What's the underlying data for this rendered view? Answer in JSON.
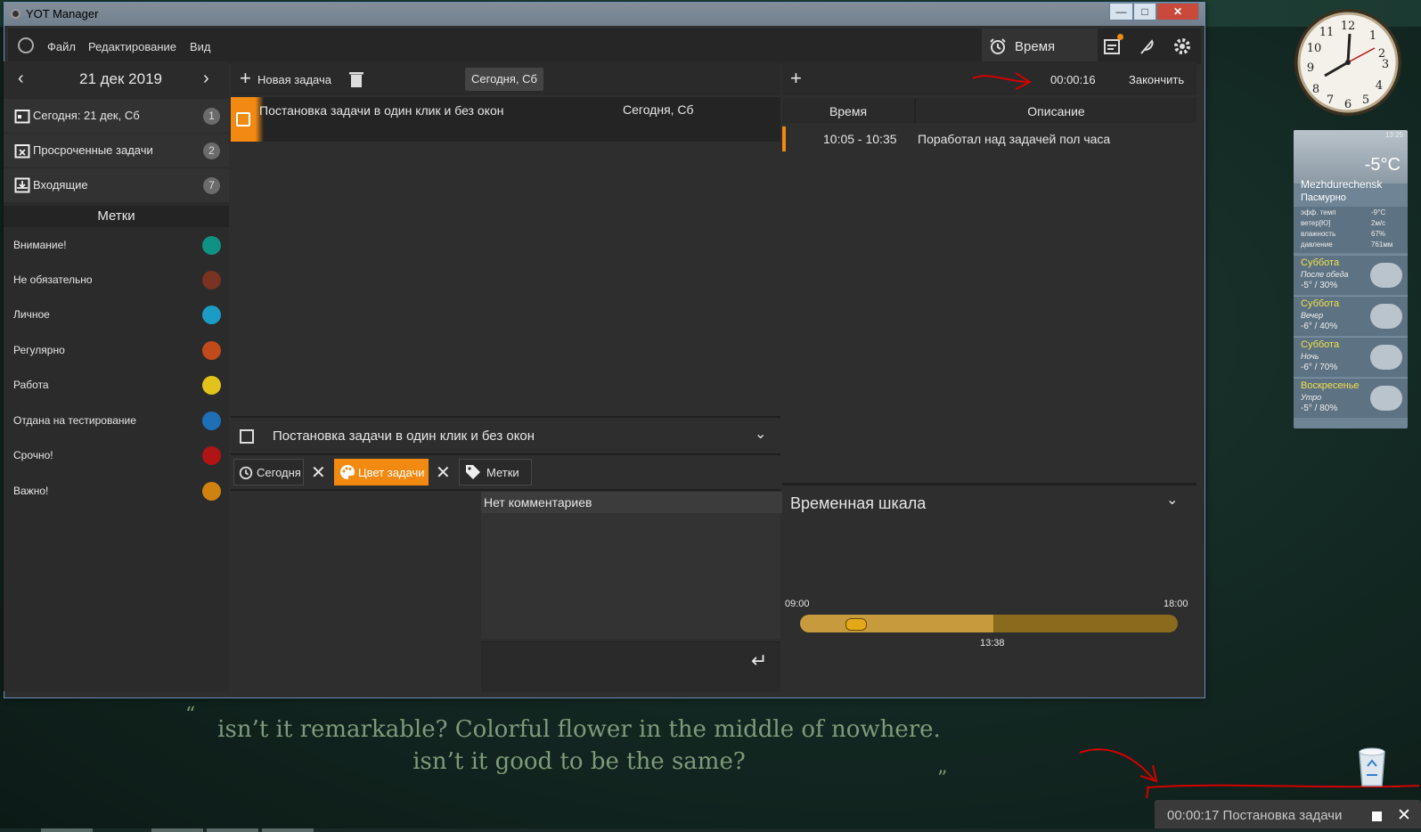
{
  "window": {
    "title": "YOT Manager"
  },
  "menu": {
    "file": "Файл",
    "edit": "Редактирование",
    "view": "Вид",
    "time_tab": "Время"
  },
  "nav": {
    "date": "21 дек 2019"
  },
  "sidebar": {
    "items": [
      {
        "label": "Сегодня: 21 дек, Сб",
        "count": "1",
        "icon": "calendar-icon"
      },
      {
        "label": "Просроченные задачи",
        "count": "2",
        "icon": "calendar-overdue-icon"
      },
      {
        "label": "Входящие",
        "count": "7",
        "icon": "inbox-icon"
      }
    ],
    "tags_header": "Метки",
    "tags": [
      {
        "label": "Внимание!",
        "color": "#0f9184"
      },
      {
        "label": "Не обязательно",
        "color": "#7a3222"
      },
      {
        "label": "Личное",
        "color": "#1c9cc4"
      },
      {
        "label": "Регулярно",
        "color": "#c14a1a"
      },
      {
        "label": "Работа",
        "color": "#e2c31c"
      },
      {
        "label": "Отдана на тестирование",
        "color": "#1f6fb6"
      },
      {
        "label": "Срочно!",
        "color": "#b01414"
      },
      {
        "label": "Важно!",
        "color": "#cf8210"
      }
    ]
  },
  "tasks_toolbar": {
    "new_task": "Новая задача",
    "filter": "Сегодня, Сб"
  },
  "task_list": [
    {
      "title": "Постановка задачи в один клик и без окон",
      "date": "Сегодня, Сб",
      "color": "#f28a12"
    }
  ],
  "task_detail": {
    "title": "Постановка задачи в один клик и без окон",
    "date_chip": "Сегодня",
    "color_chip": "Цвет задачи",
    "tags_chip": "Метки",
    "comments_empty": "Нет комментариев"
  },
  "timer": {
    "elapsed": "00:00:16",
    "finish": "Закончить"
  },
  "time_table": {
    "headers": [
      "Время",
      "Описание"
    ],
    "rows": [
      {
        "time": "10:05 - 10:35",
        "desc": "Поработал над задачей пол часа"
      }
    ]
  },
  "timeline": {
    "title": "Временная шкала",
    "start": "09:00",
    "end": "18:00",
    "now": "13:38"
  },
  "desktop": {
    "quote_open": "“",
    "quote_line1": "isn’t it remarkable? Colorful flower in the middle of nowhere.",
    "quote_line2": "isn’t it good to be the same?",
    "quote_close": "”"
  },
  "weather": {
    "time": "13:25",
    "temp": "-5°C",
    "city": "Mezhdurechensk",
    "condition": "Пасмурно",
    "details": [
      {
        "k": "эфф. темп",
        "v": "-9°C"
      },
      {
        "k": "ветер[Ю]",
        "v": "2м/с"
      },
      {
        "k": "влажность",
        "v": "67%"
      },
      {
        "k": "давление",
        "v": "761мм"
      }
    ],
    "forecast": [
      {
        "day": "Суббота",
        "part": "После обеда",
        "val": "-5°  /  30%"
      },
      {
        "day": "Суббота",
        "part": "Вечер",
        "val": "-6°  /  40%"
      },
      {
        "day": "Суббота",
        "part": "Ночь",
        "val": "-6°  /  70%"
      },
      {
        "day": "Воскресенье",
        "part": "Утро",
        "val": "-5°  /  80%"
      }
    ]
  },
  "notification": {
    "text": "00:00:17 Постановка задачи"
  }
}
